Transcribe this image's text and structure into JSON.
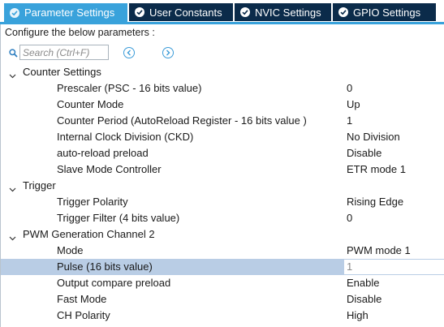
{
  "tabs": [
    {
      "label": "Parameter Settings",
      "active": true
    },
    {
      "label": "User Constants",
      "active": false
    },
    {
      "label": "NVIC Settings",
      "active": false
    },
    {
      "label": "GPIO Settings",
      "active": false
    }
  ],
  "colors": {
    "active_tab": "#39a2db",
    "inactive_tab": "#0b2b4a",
    "selected_row": "#b9cde5",
    "nav_accent": "#3a9bd8"
  },
  "header": {
    "configure_text": "Configure the below parameters :"
  },
  "search": {
    "placeholder": "Search (Ctrl+F)",
    "icon": "search-icon",
    "prev_icon": "chevron-left-circle-icon",
    "next_icon": "chevron-right-circle-icon"
  },
  "groups": [
    {
      "label": "Counter Settings",
      "params": [
        {
          "name": "Prescaler (PSC - 16 bits value)",
          "value": "0"
        },
        {
          "name": "Counter Mode",
          "value": "Up"
        },
        {
          "name": "Counter Period (AutoReload Register - 16 bits value )",
          "value": "1"
        },
        {
          "name": "Internal Clock Division (CKD)",
          "value": "No Division"
        },
        {
          "name": "auto-reload preload",
          "value": "Disable"
        },
        {
          "name": "Slave Mode Controller",
          "value": "ETR mode 1"
        }
      ]
    },
    {
      "label": "Trigger",
      "params": [
        {
          "name": "Trigger Polarity",
          "value": "Rising Edge"
        },
        {
          "name": "Trigger Filter (4 bits value)",
          "value": "0"
        }
      ]
    },
    {
      "label": "PWM Generation Channel 2",
      "params": [
        {
          "name": "Mode",
          "value": "PWM mode 1"
        },
        {
          "name": "Pulse (16 bits value)",
          "value": "1",
          "selected": true
        },
        {
          "name": "Output compare preload",
          "value": "Enable"
        },
        {
          "name": "Fast Mode",
          "value": "Disable"
        },
        {
          "name": "CH Polarity",
          "value": "High"
        }
      ]
    }
  ]
}
